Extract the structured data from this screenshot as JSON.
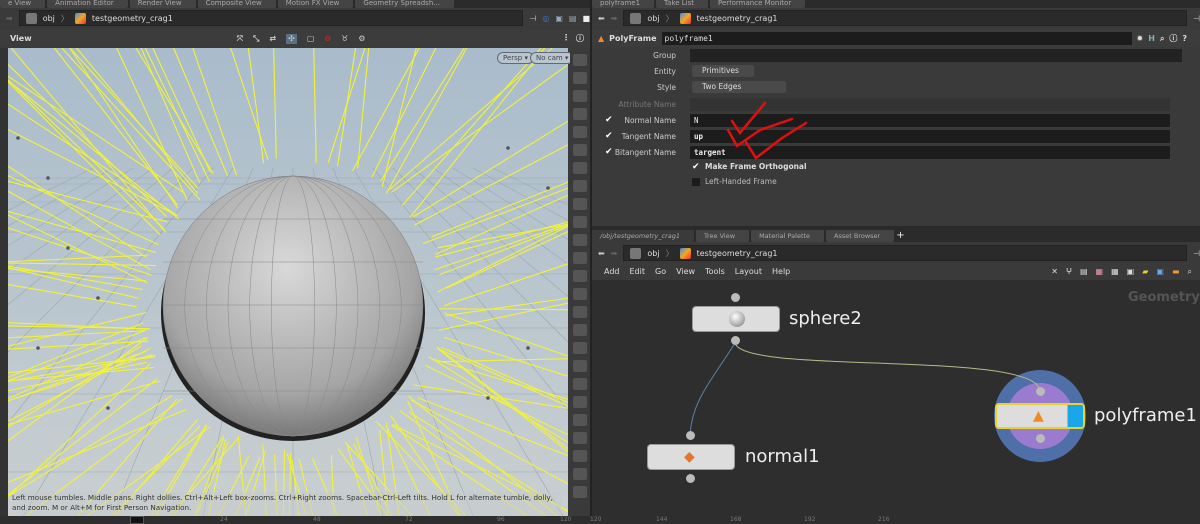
{
  "left_tabs": [
    "e View",
    "Animation Editor",
    "Render View",
    "Composite View",
    "Motion FX View",
    "Geometry Spreadsh..."
  ],
  "right_tabs": [
    "polyframe1",
    "Take List",
    "Performance Monitor"
  ],
  "path": {
    "root": "obj",
    "node": "testgeometry_crag1"
  },
  "viewer": {
    "title": "View",
    "persp": "Persp ▾",
    "cam": "No cam ▾",
    "hint": "Left mouse tumbles. Middle pans. Right dollies. Ctrl+Alt+Left box-zooms. Ctrl+Right zooms. Spacebar-Ctrl-Left tilts. Hold L for alternate tumble, dolly, and zoom.    M or Alt+M for First Person Navigation."
  },
  "params": {
    "type": "PolyFrame",
    "name": "polyframe1",
    "group_label": "Group",
    "group_value": "",
    "entity_label": "Entity",
    "entity_value": "Primitives",
    "style_label": "Style",
    "style_value": "Two Edges",
    "attr_label": "Attribute Name",
    "normal_label": "Normal Name",
    "normal_value": "N",
    "tangent_label": "Tangent Name",
    "tangent_value": "up",
    "bitangent_label": "Bitangent Name",
    "bitangent_value": "targent",
    "ortho_label": "Make Frame Orthogonal",
    "lefthanded_label": "Left-Handed Frame"
  },
  "net_tabs": [
    "/obj/testgeometry_crag1",
    "Tree View",
    "Material Palette",
    "Asset Browser"
  ],
  "net_menu": [
    "Add",
    "Edit",
    "Go",
    "View",
    "Tools",
    "Layout",
    "Help"
  ],
  "net_context": "Geometry",
  "nodes": {
    "sphere": "sphere2",
    "normal": "normal1",
    "polyframe": "polyframe1"
  },
  "timeline_left": [
    "24",
    "48",
    "72",
    "96",
    "120"
  ],
  "timeline_right": [
    "120",
    "144",
    "168",
    "192",
    "216"
  ],
  "colors": {
    "wire_yellow": "#f2f23a",
    "selected_blue": "#1aa7e8",
    "annotation_red": "#e01010"
  }
}
